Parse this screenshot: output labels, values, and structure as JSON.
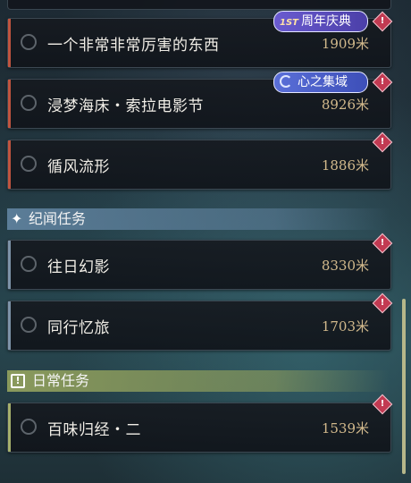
{
  "tasks_top": [
    {
      "title": "一个非常非常厉害的东西",
      "distance": "1909米",
      "tag": "1ST 周年庆典"
    },
    {
      "title": "浸梦海床・索拉电影节",
      "distance": "8926米",
      "tag": "心之集域"
    },
    {
      "title": "循风流形",
      "distance": "1886米"
    }
  ],
  "sections": {
    "story": {
      "label": "纪闻任务",
      "tasks": [
        {
          "title": "往日幻影",
          "distance": "8330米"
        },
        {
          "title": "同行忆旅",
          "distance": "1703米"
        }
      ]
    },
    "daily": {
      "label": "日常任务",
      "tasks": [
        {
          "title": "百味归经・二",
          "distance": "1539米"
        }
      ]
    }
  },
  "tags": {
    "anniversary_badge": "1ST",
    "anniversary_text": "周年庆典",
    "heart_text": "心之集域"
  },
  "icons": {
    "alert": "!",
    "section_story": "✦",
    "section_daily": "!"
  },
  "colors": {
    "bar_top": "#c0543f",
    "bar_story": "#7d93a8",
    "bar_daily": "#a5b06c",
    "section_story_bg": "#5b7d98",
    "section_daily_bg": "#8a9a5c",
    "distance": "#d2b98c"
  }
}
